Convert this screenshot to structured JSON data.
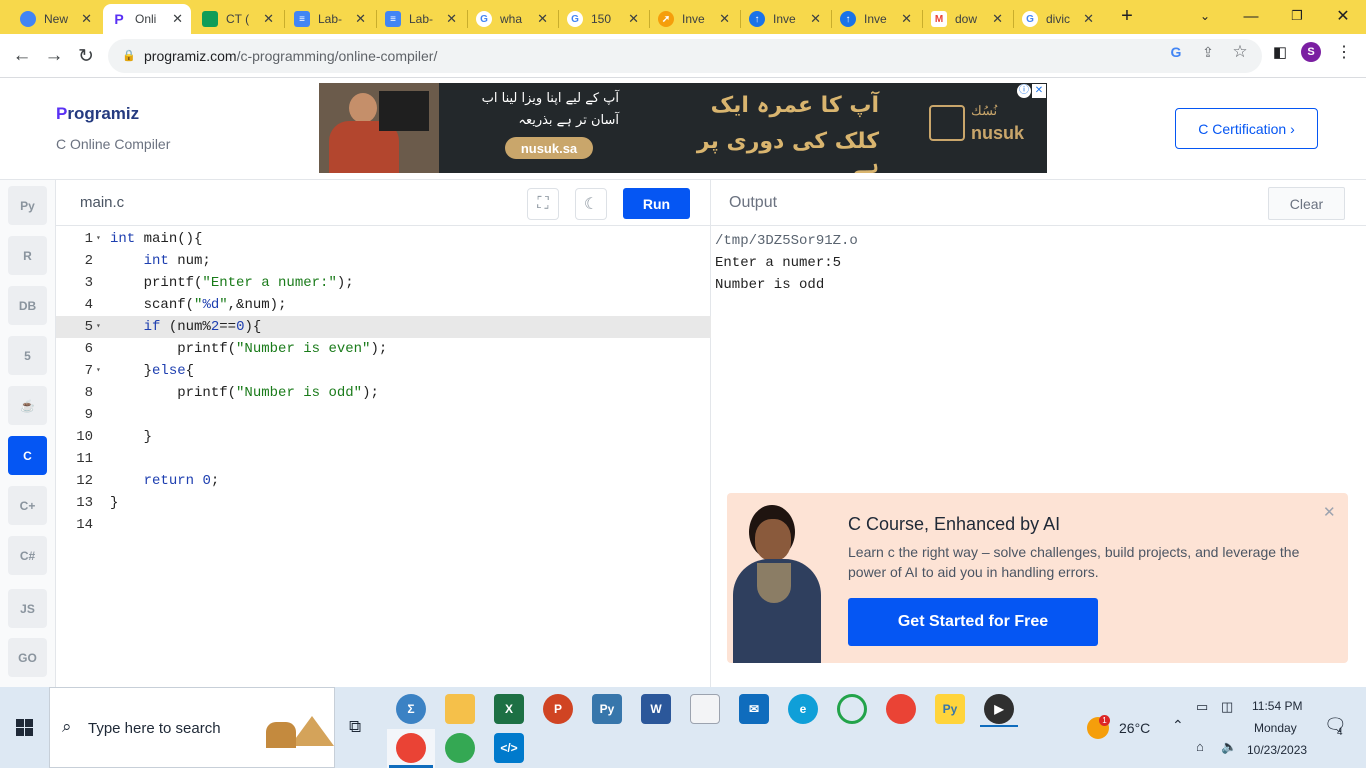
{
  "browser": {
    "tabs": [
      {
        "label": "New",
        "icon": "chrome-icon",
        "color": "#4285f4"
      },
      {
        "label": "Onli",
        "icon": "programiz-icon",
        "color": "#5a31f4",
        "active": true
      },
      {
        "label": "CT (",
        "icon": "classroom-icon",
        "color": "#0f9d58"
      },
      {
        "label": "Lab-",
        "icon": "docs-icon",
        "color": "#4285f4"
      },
      {
        "label": "Lab-",
        "icon": "docs-icon",
        "color": "#4285f4"
      },
      {
        "label": "wha",
        "icon": "google-icon",
        "color": "#ffffff"
      },
      {
        "label": "150",
        "icon": "google-icon",
        "color": "#ffffff"
      },
      {
        "label": "Inve",
        "icon": "rocket-icon",
        "color": "#f59e0b"
      },
      {
        "label": "Inve",
        "icon": "upload-icon",
        "color": "#1a73e8"
      },
      {
        "label": "Inve",
        "icon": "upload-icon",
        "color": "#1a73e8"
      },
      {
        "label": "dow",
        "icon": "gmail-icon",
        "color": "#ea4335"
      },
      {
        "label": "divic",
        "icon": "google-icon",
        "color": "#ffffff"
      }
    ],
    "url_host": "programiz.com",
    "url_path": "/c-programming/online-compiler/",
    "profile_initial": "S"
  },
  "header": {
    "logo_p": "P",
    "logo_rest": "rogramiz",
    "subtitle": "C Online Compiler",
    "cert_button": "C Certification ›",
    "ad": {
      "line1": "آپ کے لیے اپنا ویزا لینا اب",
      "line2": "آسان تر ہے بذریعہ",
      "button": "nusuk.sa",
      "big1": "آپ کا عمرہ ایک",
      "big2": "کلک کی دوری پر ہے",
      "brand": "nusuk",
      "brand_ar": "نُسُك"
    }
  },
  "languages": [
    {
      "name": "python-icon",
      "label": "Py"
    },
    {
      "name": "r-icon",
      "label": "R"
    },
    {
      "name": "sql-icon",
      "label": "DB"
    },
    {
      "name": "html5-icon",
      "label": "5"
    },
    {
      "name": "java-icon",
      "label": "☕"
    },
    {
      "name": "c-icon",
      "label": "C",
      "active": true
    },
    {
      "name": "cpp-icon",
      "label": "C+"
    },
    {
      "name": "csharp-icon",
      "label": "C#"
    },
    {
      "name": "javascript-icon",
      "label": "JS"
    },
    {
      "name": "go-icon",
      "label": "GO"
    }
  ],
  "editor": {
    "file_tab": "main.c",
    "run_label": "Run",
    "lines": [
      "1",
      "2",
      "3",
      "4",
      "5",
      "6",
      "7",
      "8",
      "9",
      "10",
      "11",
      "12",
      "13",
      "14"
    ],
    "code": {
      "l1_kw": "int",
      "l1_rest": " main(){",
      "l2_kw": "int",
      "l2_rest": " num;",
      "l3_fn": "printf(",
      "l3_str": "\"Enter a numer:\"",
      "l3_end": ");",
      "l4_fn": "scanf(",
      "l4_str1": "\"",
      "l4_fmt": "%d",
      "l4_str2": "\"",
      "l4_end": ",&num);",
      "l5_kw": "if",
      "l5_rest1": " (num%",
      "l5_num": "2",
      "l5_rest2": "==",
      "l5_num2": "0",
      "l5_rest3": "){",
      "l6_fn": "printf(",
      "l6_str": "\"Number is even\"",
      "l6_end": ");",
      "l7_open": "}",
      "l7_kw": "else",
      "l7_end": "{",
      "l8_fn": "printf(",
      "l8_str": "\"Number is odd\"",
      "l8_end": ");",
      "l10": "}",
      "l12_kw": "return",
      "l12_num": "0",
      "l12_end": ";",
      "l13": "}"
    }
  },
  "output": {
    "title": "Output",
    "clear_label": "Clear",
    "lines": [
      "/tmp/3DZ5Sor91Z.o",
      "Enter a numer:5",
      "Number is odd"
    ]
  },
  "promo": {
    "title": "C Course, Enhanced by AI",
    "text": "Learn c the right way – solve challenges, build projects, and leverage the power of AI to aid you in handling errors.",
    "button": "Get Started for Free"
  },
  "taskbar": {
    "search_placeholder": "Type here to search",
    "weather": "26°C",
    "time": "11:54 PM",
    "day": "Monday",
    "date": "10/23/2023",
    "notification_count": "4",
    "weather_badge": "1"
  }
}
